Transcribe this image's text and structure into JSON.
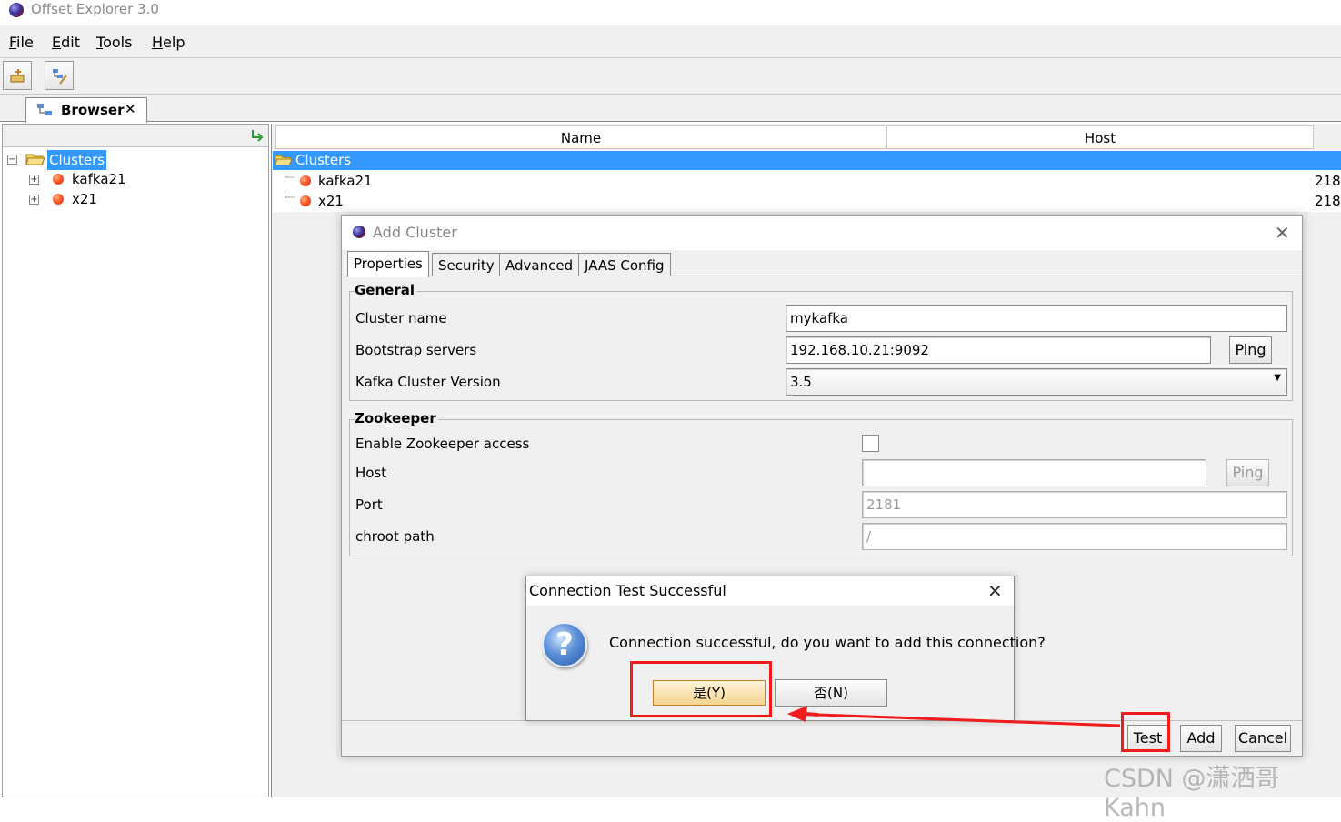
{
  "window": {
    "title": "Offset Explorer  3.0"
  },
  "menu": [
    {
      "mnemonic": "F",
      "rest": "ile"
    },
    {
      "mnemonic": "E",
      "rest": "dit"
    },
    {
      "mnemonic": "T",
      "rest": "ools"
    },
    {
      "mnemonic": "H",
      "rest": "elp"
    }
  ],
  "toolbar": {
    "icons": [
      "add-cluster-icon",
      "tree-edit-icon"
    ]
  },
  "browser_tab": {
    "label": "Browser",
    "close": "✕"
  },
  "tree": {
    "root": "Clusters",
    "items": [
      "kafka21",
      "x21"
    ]
  },
  "table": {
    "columns": [
      "Name",
      "Host"
    ],
    "rows": [
      {
        "name": "Clusters",
        "host": ""
      },
      {
        "name": "kafka21",
        "host": "218"
      },
      {
        "name": "x21",
        "host": "218"
      }
    ]
  },
  "add_cluster": {
    "title": "Add Cluster",
    "tabs": [
      "Properties",
      "Security",
      "Advanced",
      "JAAS Config"
    ],
    "general": {
      "title": "General",
      "cluster_name_label": "Cluster name",
      "cluster_name_value": "mykafka",
      "bootstrap_label": "Bootstrap servers",
      "bootstrap_value": "192.168.10.21:9092",
      "ping": "Ping",
      "version_label": "Kafka Cluster Version",
      "version_value": "3.5"
    },
    "zookeeper": {
      "title": "Zookeeper",
      "enable_label": "Enable Zookeeper access",
      "enable_checked": false,
      "host_label": "Host",
      "host_value": "",
      "ping": "Ping",
      "port_label": "Port",
      "port_value": "2181",
      "chroot_label": "chroot path",
      "chroot_value": "/"
    },
    "buttons": {
      "test": "Test",
      "add": "Add",
      "cancel": "Cancel"
    }
  },
  "confirm": {
    "title": "Connection Test Successful",
    "message": "Connection successful, do you want to add this connection?",
    "yes": "是(Y)",
    "no": "否(N)",
    "close": "✕"
  },
  "watermark": "CSDN @潇洒哥Kahn",
  "colors": {
    "selection": "#3399ff",
    "annotation": "#f01b1b"
  }
}
